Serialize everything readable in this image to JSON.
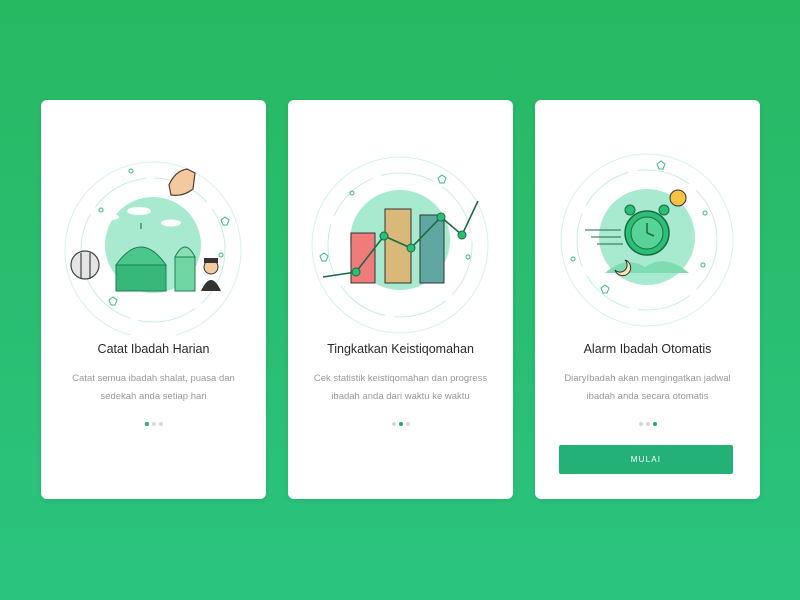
{
  "colors": {
    "background_top": "#27b862",
    "background_bottom": "#2bc47f",
    "accent": "#23b177",
    "dot_active": "#26a96c",
    "dot_inactive": "#d8d8d8"
  },
  "cards": [
    {
      "title": "Catat Ibadah Harian",
      "description": "Catat semua ibadah shalat, puasa dan sedekah anda setiap hari",
      "illustration": "mosque-illustration",
      "active_dot": 1
    },
    {
      "title": "Tingkatkan Keistiqomahan",
      "description": "Cek statistik keistiqomahan dan progress ibadah anda dari waktu ke waktu",
      "illustration": "statistics-chart-illustration",
      "active_dot": 2
    },
    {
      "title": "Alarm Ibadah Otomatis",
      "description": "DiaryIbadah akan mengingatkan jadwal ibadah anda secara otomatis",
      "illustration": "alarm-clock-illustration",
      "active_dot": 3,
      "button_label": "MULAI"
    }
  ]
}
